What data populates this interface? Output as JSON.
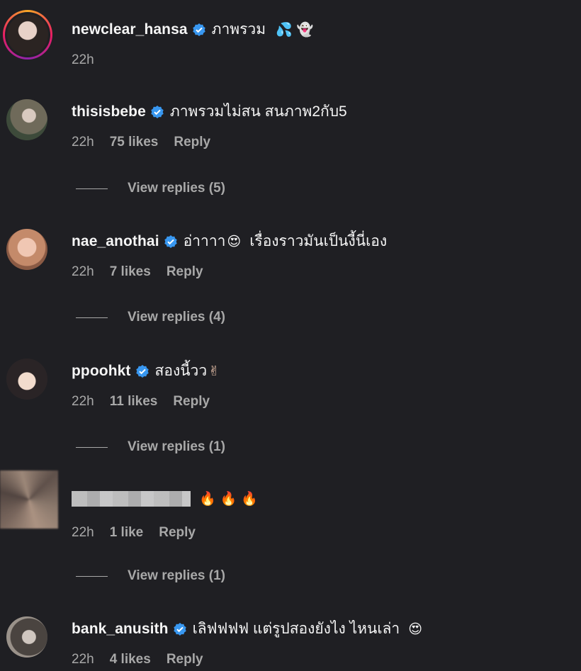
{
  "comments": [
    {
      "username": "newclear_hansa",
      "text": "ภาพรวม",
      "emoji": "💦 👻",
      "time": "22h",
      "likes": "",
      "reply": "",
      "view_replies": ""
    },
    {
      "username": "thisisbebe",
      "text": "ภาพรวมไม่สน สนภาพ2กับ5",
      "emoji": "",
      "time": "22h",
      "likes": "75 likes",
      "reply": "Reply",
      "view_replies": "View replies (5)"
    },
    {
      "username": "nae_anothai",
      "text": "อ่าาาา",
      "emoji": "😍",
      "text2": "เรื่องราวมันเป็นงี้นี่เอง",
      "time": "22h",
      "likes": "7 likes",
      "reply": "Reply",
      "view_replies": "View replies (4)"
    },
    {
      "username": "ppoohkt",
      "text": "สองนี้วว",
      "emoji": "✌",
      "time": "22h",
      "likes": "11 likes",
      "reply": "Reply",
      "view_replies": "View replies (1)"
    },
    {
      "username": "",
      "text": "",
      "emoji": "🔥 🔥 🔥",
      "time": "22h",
      "likes": "1 like",
      "reply": "Reply",
      "view_replies": "View replies (1)"
    },
    {
      "username": "bank_anusith",
      "text": "เลิฟฟฟฟ แต่รูปสองยังไง ไหนเล่า",
      "emoji": "😍",
      "time": "22h",
      "likes": "4 likes",
      "reply": "Reply",
      "view_replies": ""
    }
  ],
  "colors": {
    "background": "#1f1f23",
    "primary_text": "#f5f5f5",
    "secondary_text": "#a8a8a8",
    "verified_badge": "#3897f0"
  },
  "icons": {
    "verified": "verified-badge-icon"
  }
}
